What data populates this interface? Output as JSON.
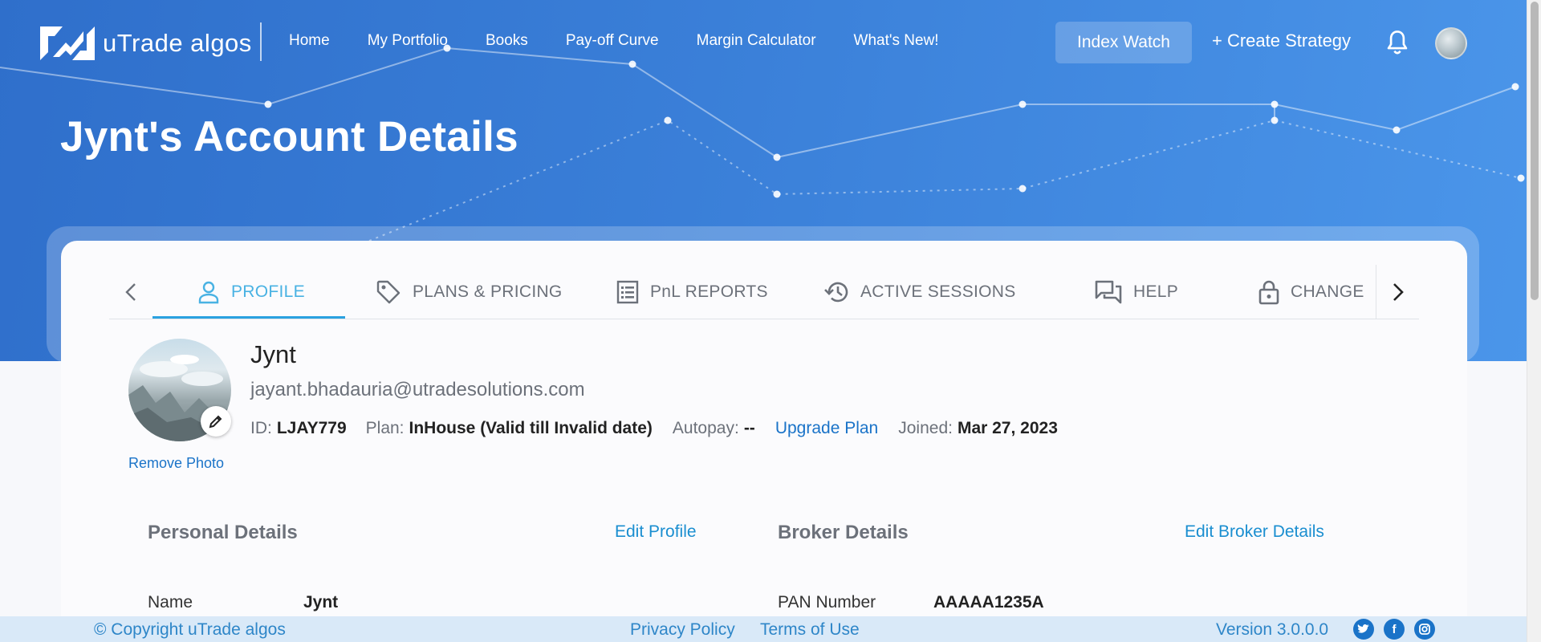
{
  "brand": {
    "name": "uTrade algos"
  },
  "nav": {
    "links": [
      "Home",
      "My Portfolio",
      "Books",
      "Pay-off Curve",
      "Margin Calculator",
      "What's New!"
    ],
    "index_watch": "Index Watch",
    "create_strategy": "+ Create Strategy"
  },
  "page_title": "Jynt's Account Details",
  "tabs": [
    {
      "label": "PROFILE",
      "icon": "person-icon",
      "active": true
    },
    {
      "label": "PLANS & PRICING",
      "icon": "tag-icon",
      "active": false
    },
    {
      "label": "PnL REPORTS",
      "icon": "report-list-icon",
      "active": false
    },
    {
      "label": "ACTIVE SESSIONS",
      "icon": "history-icon",
      "active": false
    },
    {
      "label": "HELP",
      "icon": "chat-bubbles-icon",
      "active": false
    },
    {
      "label": "CHANGE",
      "icon": "lock-icon",
      "active": false
    }
  ],
  "profile": {
    "name": "Jynt",
    "email": "jayant.bhadauria@utradesolutions.com",
    "remove_photo": "Remove Photo",
    "id_label": "ID:",
    "id_value": "LJAY779",
    "plan_label": "Plan:",
    "plan_value": "InHouse (Valid till Invalid date)",
    "autopay_label": "Autopay:",
    "autopay_value": "--",
    "upgrade_plan": "Upgrade Plan",
    "joined_label": "Joined:",
    "joined_value": "Mar 27, 2023"
  },
  "personal_details": {
    "title": "Personal Details",
    "edit_link": "Edit Profile",
    "rows": [
      {
        "label": "Name",
        "value": "Jynt"
      }
    ]
  },
  "broker_details": {
    "title": "Broker Details",
    "edit_link": "Edit Broker Details",
    "rows": [
      {
        "label": "PAN Number",
        "value": "AAAAA1235A"
      }
    ]
  },
  "footer": {
    "copyright": "© Copyright uTrade algos",
    "privacy": "Privacy Policy",
    "terms": "Terms of Use",
    "version": "Version 3.0.0.0",
    "social": [
      "twitter-icon",
      "facebook-icon",
      "instagram-icon"
    ]
  },
  "colors": {
    "hero": "#3a7fd8",
    "accent": "#49b2e3",
    "link": "#1a73c8",
    "footer_bg": "#d9e9f8"
  }
}
